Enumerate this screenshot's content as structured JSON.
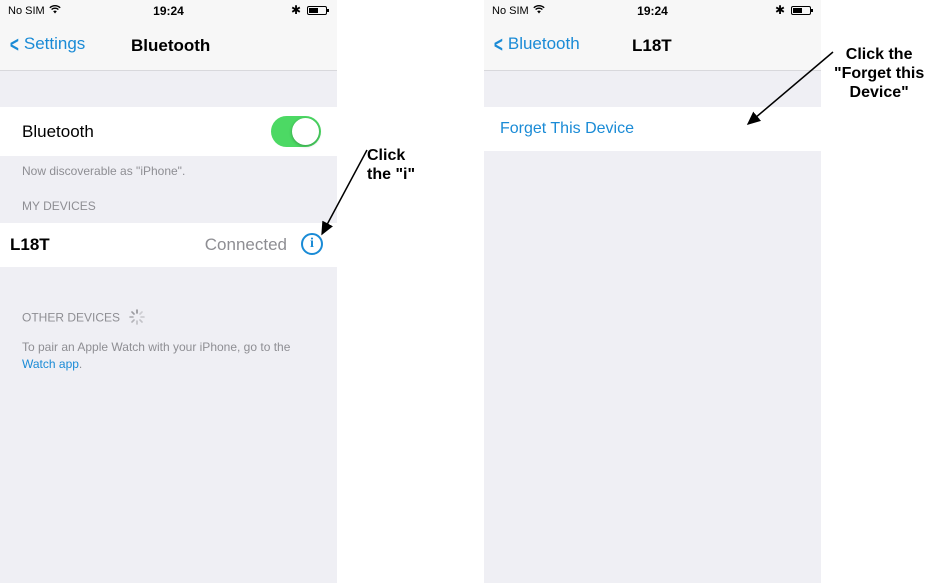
{
  "screen_left": {
    "status": {
      "carrier": "No SIM",
      "time": "19:24",
      "bt": "✱"
    },
    "nav": {
      "back_label": "Settings",
      "title": "Bluetooth"
    },
    "bluetooth_row": {
      "label": "Bluetooth",
      "toggle": "on"
    },
    "discoverable_text": "Now discoverable as \"iPhone\".",
    "my_devices_header": "MY DEVICES",
    "device": {
      "name": "L18T",
      "status": "Connected"
    },
    "other_devices_header": "OTHER DEVICES",
    "pair_text_prefix": "To pair an Apple Watch with your iPhone, go to the",
    "pair_link": "Watch app",
    "pair_text_suffix": "."
  },
  "screen_right": {
    "status": {
      "carrier": "No SIM",
      "time": "19:24",
      "bt": "✱"
    },
    "nav": {
      "back_label": "Bluetooth",
      "title": "L18T"
    },
    "forget_label": "Forget This Device"
  },
  "annotations": {
    "click_i": [
      "Click",
      "the \"i\""
    ],
    "click_forget": [
      "Click the",
      "\"Forget this",
      "Device\""
    ]
  },
  "colors": {
    "accent": "#1a8bd6",
    "toggle_on": "#4cd964"
  }
}
